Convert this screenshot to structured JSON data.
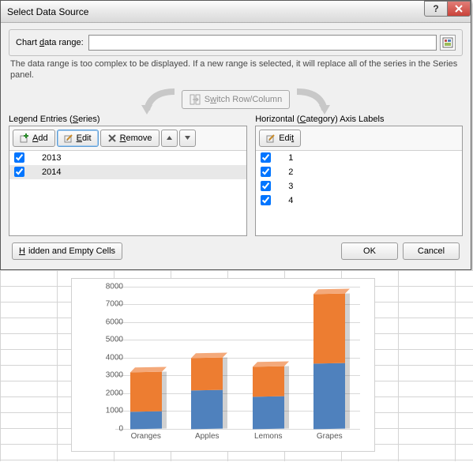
{
  "dialog": {
    "title": "Select Data Source",
    "range_label_pre": "Chart ",
    "range_label_u": "d",
    "range_label_post": "ata range:",
    "range_value": "",
    "help_text": "The data range is too complex to be displayed. If a new range is selected, it will replace all of the series in the Series panel.",
    "switch_label_pre": "S",
    "switch_label_u": "w",
    "switch_label_post": "itch Row/Column",
    "legend_head_pre": "Legend Entries (",
    "legend_head_u": "S",
    "legend_head_post": "eries)",
    "axis_head_pre": "Horizontal (",
    "axis_head_u": "C",
    "axis_head_post": "ategory) Axis Labels",
    "add_label_u": "A",
    "add_label_post": "dd",
    "edit_label_u": "E",
    "edit_label_post": "dit",
    "edit2_label_pre": "Edi",
    "edit2_label_u": "t",
    "remove_label_u": "R",
    "remove_label_post": "emove",
    "series": [
      {
        "label": "2013",
        "checked": true,
        "selected": false
      },
      {
        "label": "2014",
        "checked": true,
        "selected": true
      }
    ],
    "categories": [
      {
        "label": "1",
        "checked": true
      },
      {
        "label": "2",
        "checked": true
      },
      {
        "label": "3",
        "checked": true
      },
      {
        "label": "4",
        "checked": true
      }
    ],
    "hidden_label_u": "H",
    "hidden_label_post": "idden and Empty Cells",
    "ok": "OK",
    "cancel": "Cancel"
  },
  "chart_data": {
    "type": "bar",
    "stacked": true,
    "categories": [
      "Oranges",
      "Apples",
      "Lemons",
      "Grapes"
    ],
    "series": [
      {
        "name": "2013",
        "color": "#4f81bd",
        "values": [
          1000,
          2200,
          1800,
          3700
        ]
      },
      {
        "name": "2014",
        "color": "#ed7d31",
        "values": [
          2200,
          1800,
          1700,
          3900
        ]
      }
    ],
    "ylim": [
      0,
      8000
    ],
    "ytick_step": 1000,
    "title": "",
    "xlabel": "",
    "ylabel": ""
  }
}
